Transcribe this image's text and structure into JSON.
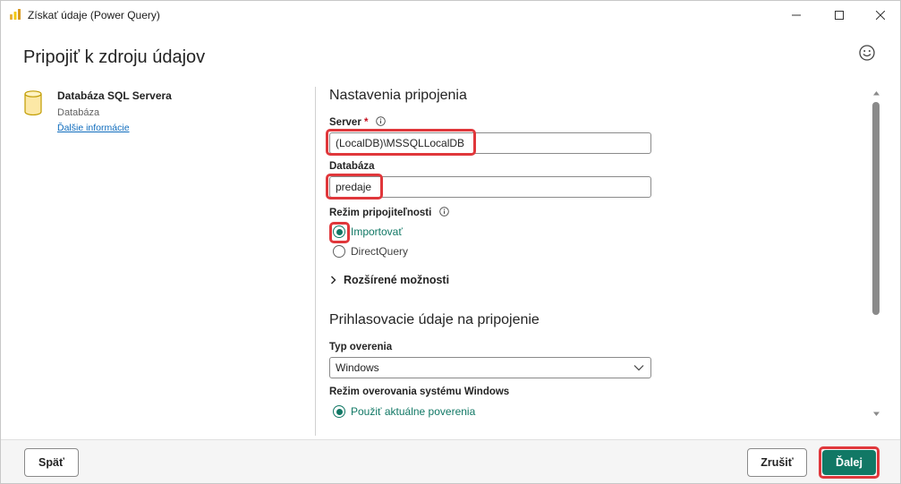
{
  "window": {
    "title": "Získať údaje (Power Query)"
  },
  "header": {
    "title": "Pripojiť k zdroju údajov"
  },
  "source": {
    "name": "Databáza SQL Servera",
    "type": "Databáza",
    "more_info": "Ďalšie informácie"
  },
  "connection": {
    "section_title": "Nastavenia pripojenia",
    "server_label": "Server",
    "server_required": "*",
    "server_value": "(LocalDB)\\MSSQLLocalDB",
    "database_label": "Databáza",
    "database_value": "predaje",
    "mode_label": "Režim pripojiteľnosti",
    "mode_options": [
      {
        "label": "Importovať",
        "selected": true
      },
      {
        "label": "DirectQuery",
        "selected": false
      }
    ],
    "advanced_label": "Rozšírené možnosti"
  },
  "credentials": {
    "section_title": "Prihlasovacie údaje na pripojenie",
    "auth_type_label": "Typ overenia",
    "auth_type_value": "Windows",
    "windows_mode_label": "Režim overovania systému Windows",
    "windows_mode_options": [
      {
        "label": "Použiť aktuálne poverenia",
        "selected": true
      }
    ]
  },
  "footer": {
    "back_label": "Späť",
    "cancel_label": "Zrušiť",
    "next_label": "Ďalej"
  },
  "colors": {
    "accent": "#117865",
    "highlight": "#e0373b",
    "link": "#0f6cbd"
  },
  "icons": {
    "app": "power-bi-icon",
    "source": "database-icon",
    "feedback": "smiley-icon"
  }
}
